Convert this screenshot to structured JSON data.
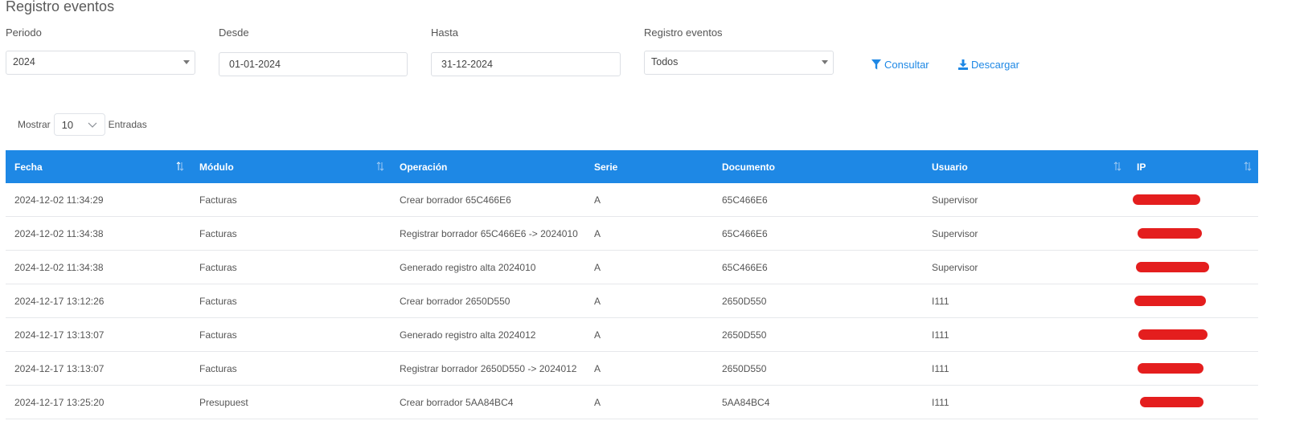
{
  "page": {
    "title": "Registro eventos"
  },
  "filters": {
    "periodo": {
      "label": "Periodo",
      "value": "2024"
    },
    "desde": {
      "label": "Desde",
      "value": "01-01-2024"
    },
    "hasta": {
      "label": "Hasta",
      "value": "31-12-2024"
    },
    "registro": {
      "label": "Registro eventos",
      "value": "Todos"
    }
  },
  "actions": {
    "consultar": "Consultar",
    "descargar": "Descargar"
  },
  "length_menu": {
    "before": "Mostrar",
    "value": "10",
    "after": "Entradas"
  },
  "table": {
    "columns": [
      "Fecha",
      "Módulo",
      "Operación",
      "Serie",
      "Documento",
      "Usuario",
      "IP"
    ],
    "rows": [
      [
        "2024-12-02 11:34:29",
        "Facturas",
        "Crear borrador 65C466E6",
        "A",
        "65C466E6",
        "Supervisor",
        ""
      ],
      [
        "2024-12-02 11:34:38",
        "Facturas",
        "Registrar borrador 65C466E6 -> 2024010",
        "A",
        "65C466E6",
        "Supervisor",
        ""
      ],
      [
        "2024-12-02 11:34:38",
        "Facturas",
        "Generado registro alta 2024010",
        "A",
        "65C466E6",
        "Supervisor",
        ""
      ],
      [
        "2024-12-17 13:12:26",
        "Facturas",
        "Crear borrador 2650D550",
        "A",
        "2650D550",
        "I111",
        ""
      ],
      [
        "2024-12-17 13:13:07",
        "Facturas",
        "Generado registro alta 2024012",
        "A",
        "2650D550",
        "I111",
        ""
      ],
      [
        "2024-12-17 13:13:07",
        "Facturas",
        "Registrar borrador 2650D550 -> 2024012",
        "A",
        "2650D550",
        "I111",
        ""
      ],
      [
        "2024-12-17 13:25:20",
        "Presupuest",
        "Crear borrador 5AA84BC4",
        "A",
        "5AA84BC4",
        "I111",
        ""
      ]
    ]
  },
  "colors": {
    "accent": "#1e88e5",
    "redaction": "#e41e1e",
    "header_text": "#ffffff"
  },
  "icons": {
    "consultar": "filter-icon",
    "descargar": "download-icon",
    "sort": "sort-icon",
    "select": "caret-down-icon"
  }
}
